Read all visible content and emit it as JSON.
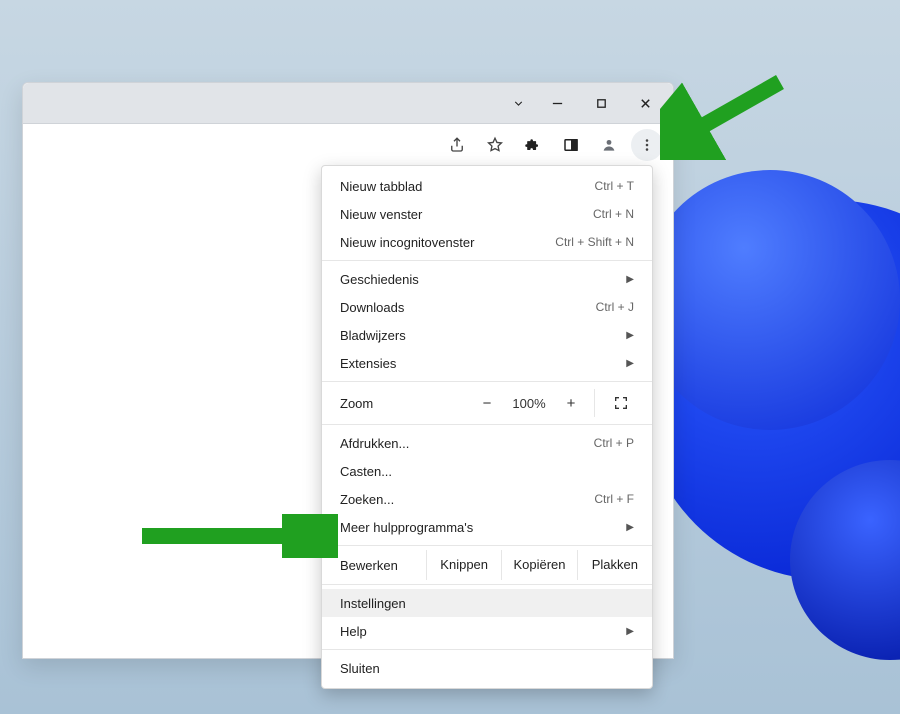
{
  "titlebar": {
    "tab_chevron_title": "Zoeken in tabbladen",
    "minimize_title": "Minimaliseren",
    "maximize_title": "Maximaliseren",
    "close_title": "Sluiten"
  },
  "toolbar": {
    "share_title": "Delen",
    "star_title": "Bladwijzer",
    "extensions_title": "Extensies",
    "sidepanel_title": "Zijpaneel",
    "profile_title": "Profiel",
    "menu_title": "Menu"
  },
  "menu": {
    "new_tab": {
      "label": "Nieuw tabblad",
      "shortcut": "Ctrl + T"
    },
    "new_window": {
      "label": "Nieuw venster",
      "shortcut": "Ctrl + N"
    },
    "new_incognito": {
      "label": "Nieuw incognitovenster",
      "shortcut": "Ctrl + Shift + N"
    },
    "history": {
      "label": "Geschiedenis"
    },
    "downloads": {
      "label": "Downloads",
      "shortcut": "Ctrl + J"
    },
    "bookmarks": {
      "label": "Bladwijzers"
    },
    "extensions": {
      "label": "Extensies"
    },
    "zoom": {
      "label": "Zoom",
      "minus": "−",
      "value": "100%",
      "plus": "+"
    },
    "print": {
      "label": "Afdrukken...",
      "shortcut": "Ctrl + P"
    },
    "cast": {
      "label": "Casten..."
    },
    "find": {
      "label": "Zoeken...",
      "shortcut": "Ctrl + F"
    },
    "more_tools": {
      "label": "Meer hulpprogramma's"
    },
    "edit": {
      "label": "Bewerken",
      "cut": "Knippen",
      "copy": "Kopiëren",
      "paste": "Plakken"
    },
    "settings": {
      "label": "Instellingen"
    },
    "help": {
      "label": "Help"
    },
    "exit": {
      "label": "Sluiten"
    }
  }
}
